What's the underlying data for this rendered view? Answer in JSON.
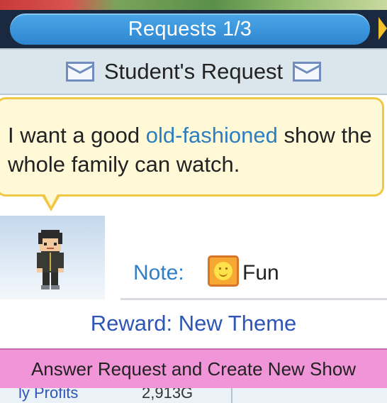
{
  "title": {
    "text": "Requests 1/3"
  },
  "header": {
    "text": "Student's Request",
    "icon_left": "envelope-icon",
    "icon_right": "envelope-icon"
  },
  "speech": {
    "before": "I want a good ",
    "highlight": "old-fashioned",
    "after": " show the whole family can watch.",
    "highlight_color": "#2d7ec0"
  },
  "portrait": {
    "icon": "student-sprite"
  },
  "note": {
    "label": "Note:",
    "icon": "fun-smiley-icon",
    "value": "Fun"
  },
  "reward": {
    "text": "Reward: New Theme",
    "color": "#2f56b6"
  },
  "action": {
    "label": "Answer Request and Create New Show",
    "color": "#f096d8"
  },
  "bottom": {
    "left": "ly Profits",
    "mid": "2,913G"
  }
}
